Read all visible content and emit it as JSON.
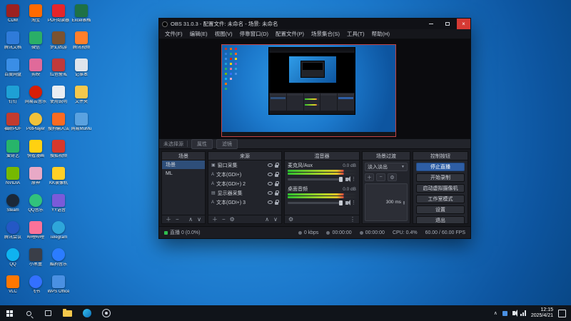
{
  "desktop": {
    "icons": [
      {
        "label": "CDM",
        "color": "#9c2121"
      },
      {
        "label": "腾讯文档",
        "color": "#2f7bd9"
      },
      {
        "label": "百度网盘",
        "color": "#3a8ee6"
      },
      {
        "label": "钉钉",
        "color": "#1ea0d5"
      },
      {
        "label": "福昕PDF",
        "color": "#c23b2e"
      },
      {
        "label": "爱奇艺",
        "color": "#27b56a"
      },
      {
        "label": "NVIDIA",
        "color": "#76b900"
      },
      {
        "label": "Steam",
        "color": "#1b2838",
        "round": true
      },
      {
        "label": "腾讯会议",
        "color": "#2458c5",
        "round": true
      },
      {
        "label": "QQ",
        "color": "#0fb3f0",
        "round": true
      },
      {
        "label": "VLC",
        "color": "#ff7700"
      },
      {
        "label": "淘宝",
        "color": "#ff6a00"
      },
      {
        "label": "微信",
        "color": "#2aae67"
      },
      {
        "label": "剪映",
        "color": "#e06a9a"
      },
      {
        "label": "网易云音乐",
        "color": "#d81e06",
        "round": true
      },
      {
        "label": "PotPlayer",
        "color": "#f2c23a",
        "round": true
      },
      {
        "label": "快看漫画",
        "color": "#ffd111"
      },
      {
        "label": "原神",
        "color": "#e8a9c6"
      },
      {
        "label": "QQ音乐",
        "color": "#31c27c",
        "round": true
      },
      {
        "label": "哔哩哔哩",
        "color": "#fb7299"
      },
      {
        "label": "小黑盒",
        "color": "#3a3e48"
      },
      {
        "label": "飞书",
        "color": "#3370ff",
        "round": true
      },
      {
        "label": "PDF阅读器",
        "color": "#e5252a"
      },
      {
        "label": "梦幻西游",
        "color": "#7a5230"
      },
      {
        "label": "红色警戒",
        "color": "#c03a3a"
      },
      {
        "label": "使用说明",
        "color": "#e9edf2"
      },
      {
        "label": "搜狗输入法",
        "color": "#fb6b22"
      },
      {
        "label": "搜狐视频",
        "color": "#d6382b"
      },
      {
        "label": "KK录像机",
        "color": "#ffcf26"
      },
      {
        "label": "YY语音",
        "color": "#7a5ad9"
      },
      {
        "label": "Telegram",
        "color": "#2ea6da",
        "round": true
      },
      {
        "label": "酷狗音乐",
        "color": "#2b7cff",
        "round": true
      },
      {
        "label": "WPS Office",
        "color": "#4a90e2"
      },
      {
        "label": "Excel表格",
        "color": "#1e7145"
      },
      {
        "label": "腾讯视频",
        "color": "#ff7f2a"
      },
      {
        "label": "记事本",
        "color": "#dfe5ec"
      },
      {
        "label": "文件夹",
        "color": "#f5c84c"
      },
      {
        "label": "网易MuMu",
        "color": "#5aa2e0"
      }
    ]
  },
  "obs": {
    "window_title": "OBS 31.0.3 - 配置文件: 未命名 - 场景: 未命名",
    "menu": [
      "文件(F)",
      "编辑(E)",
      "视图(V)",
      "停靠窗口(D)",
      "配置文件(P)",
      "场景集合(S)",
      "工具(T)",
      "帮助(H)"
    ],
    "source_toolbar": {
      "no_source": "未选择源",
      "properties": "属性",
      "filters": "滤镜"
    },
    "scenes_dock": {
      "title": "场景",
      "items": [
        {
          "label": "场景",
          "selected": true
        },
        {
          "label": "ML",
          "selected": false
        }
      ]
    },
    "sources_dock": {
      "title": "来源",
      "items": [
        {
          "glyph": "▣",
          "name": "窗口采集"
        },
        {
          "glyph": "A",
          "name": "文本(GDI+)"
        },
        {
          "glyph": "A",
          "name": "文本(GDI+) 2"
        },
        {
          "glyph": "▤",
          "name": "显示器采集"
        },
        {
          "glyph": "A",
          "name": "文本(GDI+) 3"
        }
      ]
    },
    "mixer_dock": {
      "title": "混音器",
      "channels": [
        {
          "name": "麦克风/Aux",
          "db": "0.0 dB"
        },
        {
          "name": "桌面音频",
          "db": "0.0 dB"
        }
      ]
    },
    "transitions_dock": {
      "title": "场景过渡",
      "selected": "淡入淡出",
      "duration": "300 ms"
    },
    "controls_dock": {
      "title": "控制按钮",
      "buttons": [
        {
          "label": "停止直播",
          "primary": true
        },
        {
          "label": "开始录制"
        },
        {
          "label": "启动虚拟摄像机"
        },
        {
          "label": "工作室模式"
        },
        {
          "label": "设置"
        },
        {
          "label": "退出"
        }
      ]
    },
    "status_bar": {
      "stream_health": "直播 0 (0.0%)",
      "bitrate": "0 kbps",
      "rec_time": "00:00:00",
      "live_time": "00:00:00",
      "cpu": "CPU: 0.4%",
      "fps": "60.00 / 60.00 FPS"
    }
  },
  "taskbar": {
    "time": "12:15",
    "date": "2025/4/21"
  }
}
